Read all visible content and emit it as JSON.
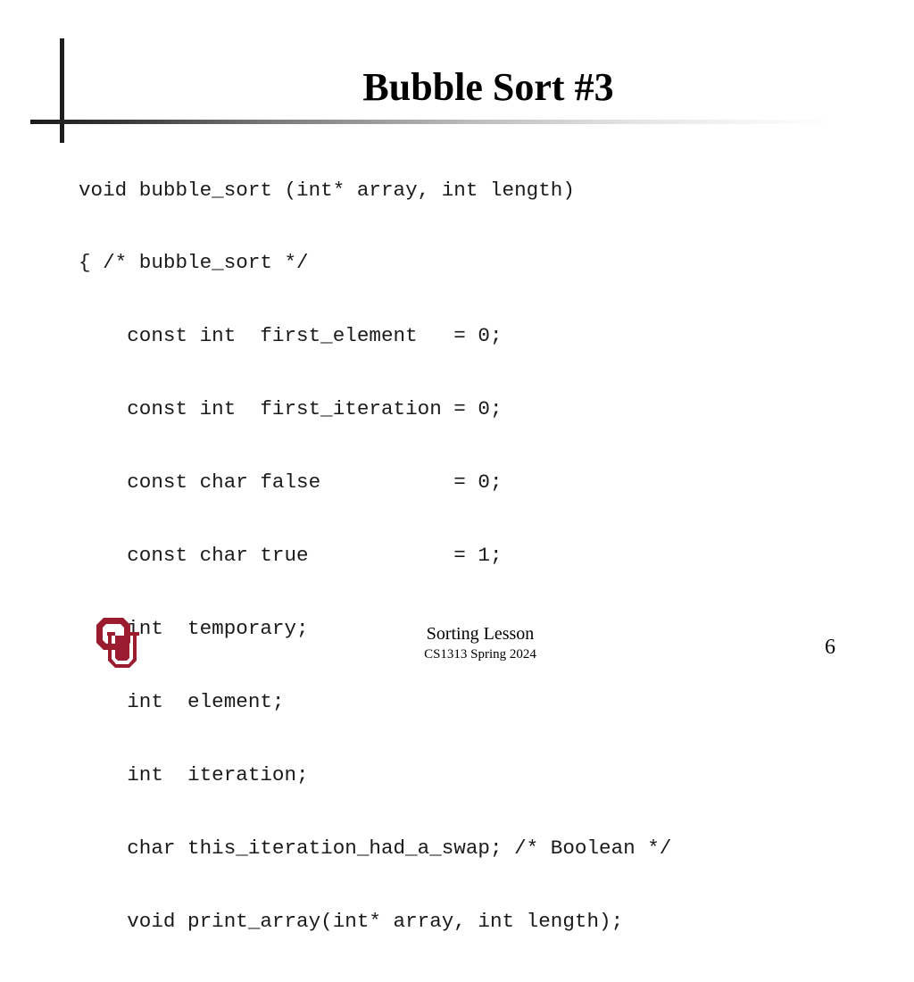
{
  "slide": {
    "title": "Bubble Sort #3",
    "code_lines": [
      "void bubble_sort (int* array, int length)",
      "{ /* bubble_sort */",
      "    const int  first_element   = 0;",
      "    const int  first_iteration = 0;",
      "    const char false           = 0;",
      "    const char true            = 1;",
      "    int  temporary;",
      "    int  element;",
      "    int  iteration;",
      "    char this_iteration_had_a_swap; /* Boolean */",
      "    void print_array(int* array, int length);"
    ],
    "logo": {
      "icon": "ou-interlocking-logo",
      "color": "#9b1c2e"
    }
  },
  "footer": {
    "title": "Sorting Lesson",
    "course": "CS1313 Spring 2024",
    "page_number": "6"
  }
}
